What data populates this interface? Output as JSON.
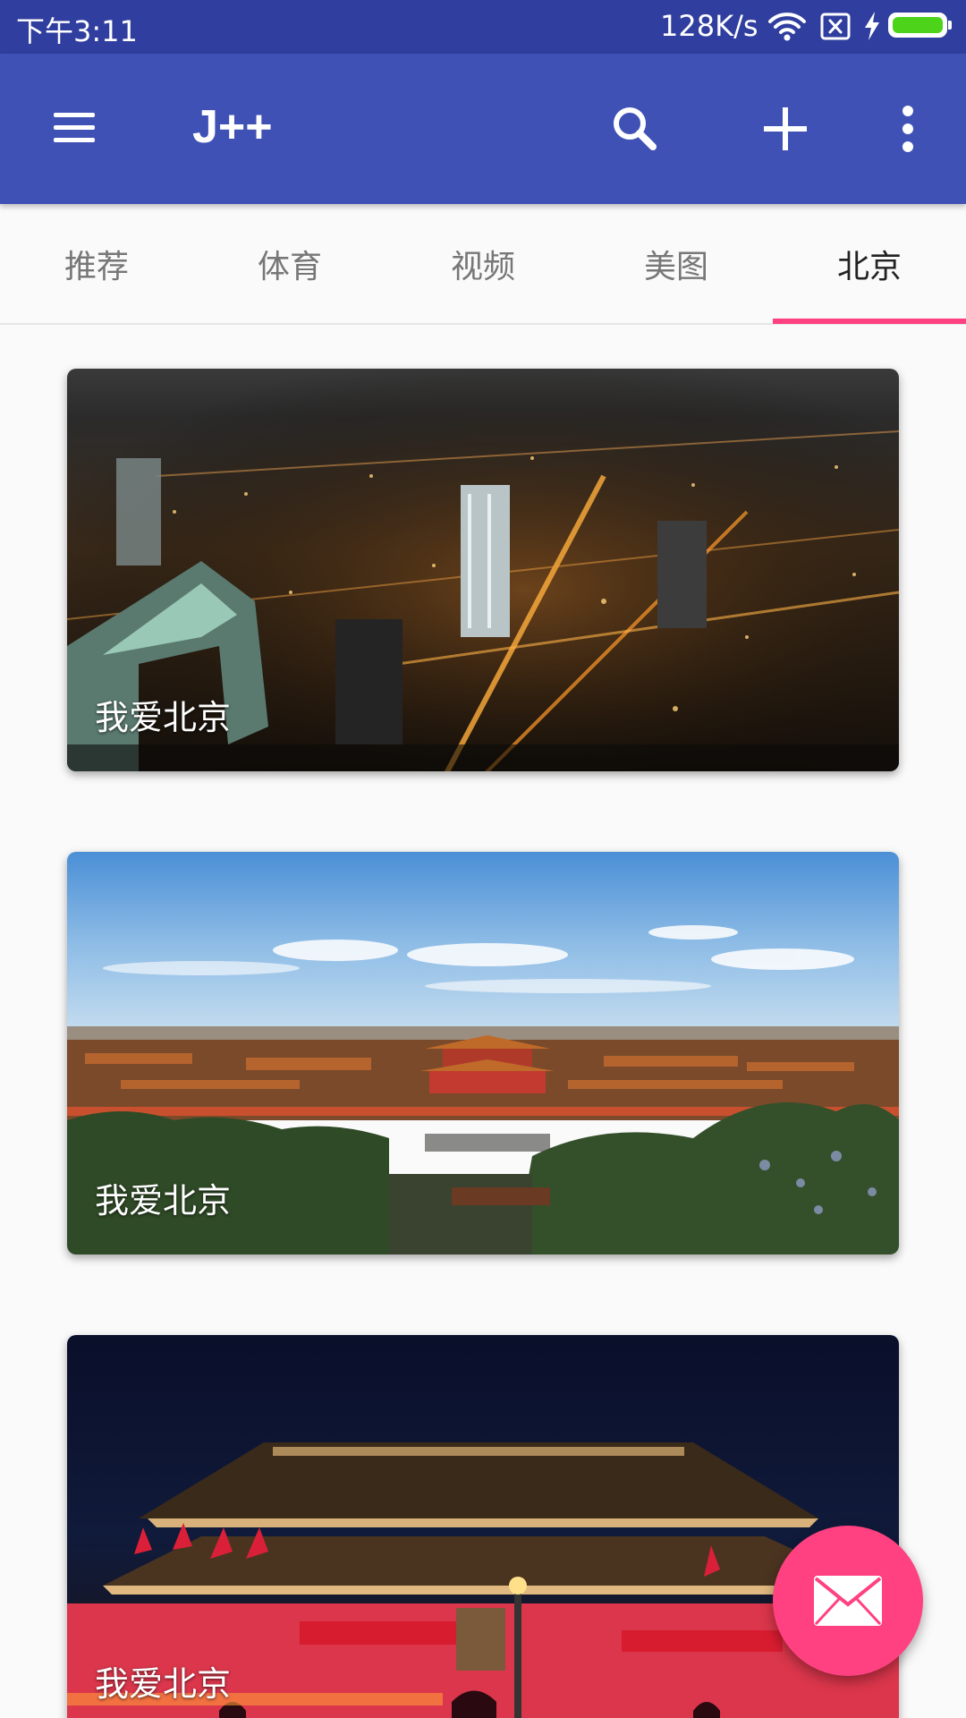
{
  "status_bar": {
    "time": "下午3:11",
    "network_speed": "128K/s",
    "icons": [
      "wifi-icon",
      "sim-x-icon",
      "charging-bolt-icon",
      "battery-icon"
    ],
    "battery_color": "#4cd31a"
  },
  "toolbar": {
    "title": "J++",
    "background": "#3f51b5",
    "icons": [
      "menu-icon",
      "search-icon",
      "add-icon",
      "more-vert-icon"
    ]
  },
  "tabs": {
    "items": [
      {
        "label": "推荐"
      },
      {
        "label": "体育"
      },
      {
        "label": "视频"
      },
      {
        "label": "美图"
      },
      {
        "label": "北京"
      }
    ],
    "selected_index": 4,
    "indicator_color": "#ff4081"
  },
  "cards": [
    {
      "caption": "我爱北京",
      "image": "beijing-night-skyline"
    },
    {
      "caption": "我爱北京",
      "image": "forbidden-city-daytime"
    },
    {
      "caption": "我爱北京",
      "image": "tiananmen-night"
    }
  ],
  "fab": {
    "icon": "mail-icon",
    "color": "#ff4081"
  }
}
